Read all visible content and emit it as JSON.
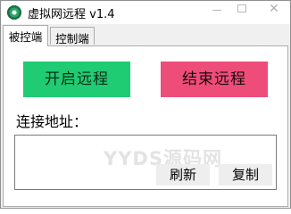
{
  "window": {
    "title": "虚拟网远程 v1.4",
    "close_glyph": "✕"
  },
  "tabs": [
    {
      "label": "被控端",
      "active": true
    },
    {
      "label": "控制端",
      "active": false
    }
  ],
  "controlled": {
    "start_label": "开启远程",
    "stop_label": "结束远程",
    "address_label": "连接地址：",
    "address_value": "",
    "refresh_label": "刷新",
    "copy_label": "复制"
  },
  "watermark": "YYDS源码网",
  "colors": {
    "start_button": "#1fcc73",
    "stop_button": "#ee4d7a"
  }
}
